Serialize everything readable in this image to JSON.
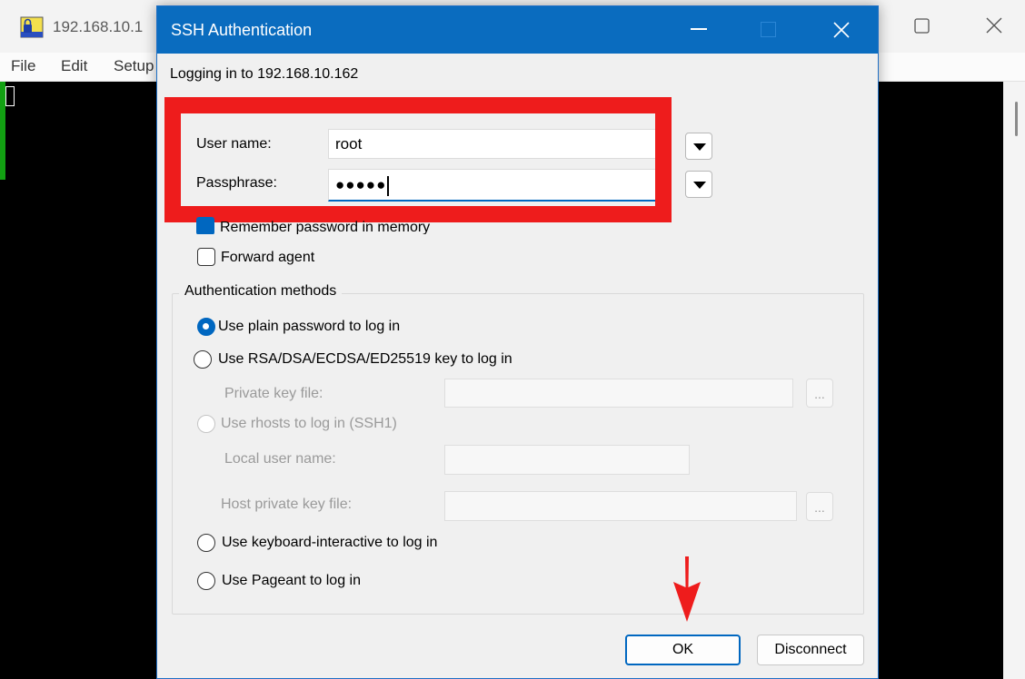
{
  "background_window": {
    "title": "192.168.10.1",
    "menu": [
      "File",
      "Edit",
      "Setup"
    ]
  },
  "dialog": {
    "title": "SSH Authentication",
    "login_text": "Logging in to 192.168.10.162",
    "username_label": "User name:",
    "username_value": "root",
    "passphrase_label": "Passphrase:",
    "passphrase_value": "●●●●●",
    "remember_label": "Remember password in memory",
    "forward_agent_label": "Forward agent",
    "auth_methods_legend": "Authentication methods",
    "methods": {
      "plain_password": "Use plain password to log in",
      "rsa_key": "Use RSA/DSA/ECDSA/ED25519 key to log in",
      "private_key_label": "Private key file:",
      "rhosts": "Use rhosts to log in (SSH1)",
      "local_user_label": "Local user name:",
      "host_private_key_label": "Host private key file:",
      "keyboard_interactive": "Use keyboard-interactive to log in",
      "pageant": "Use Pageant to log in"
    },
    "ellipsis": "...",
    "ok_label": "OK",
    "disconnect_label": "Disconnect"
  },
  "colors": {
    "accent": "#0067c0",
    "titlebar": "#0a6cbf",
    "highlight": "#ee1c1c",
    "terminal": "#000000"
  }
}
